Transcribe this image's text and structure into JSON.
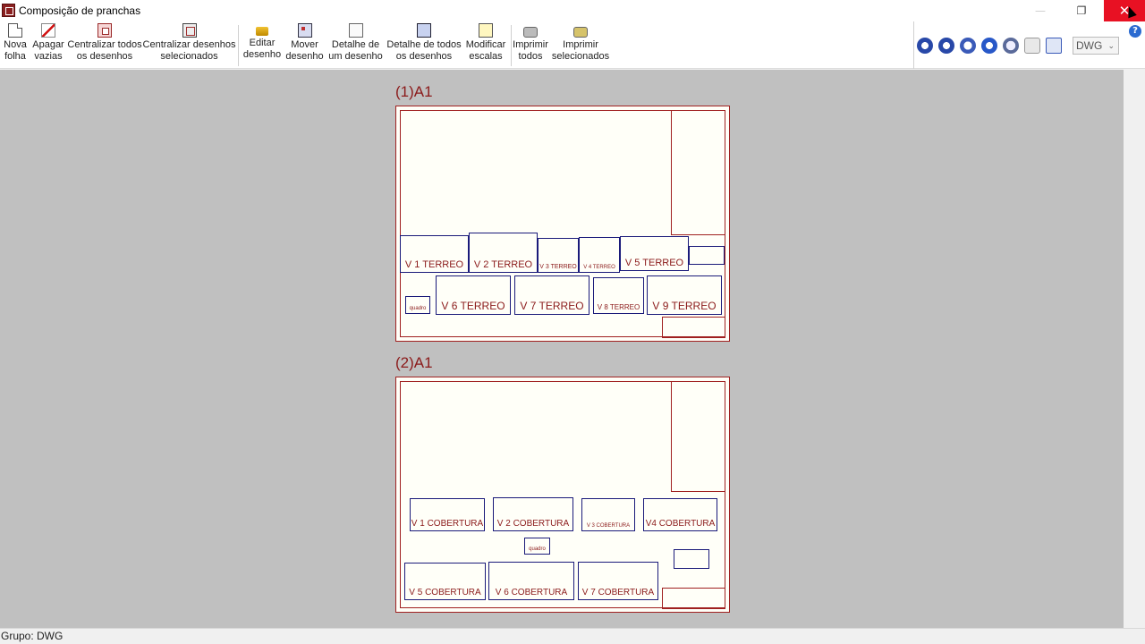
{
  "window": {
    "title": "Composição de pranchas",
    "minimize": "—",
    "restore": "❐",
    "close": "✕"
  },
  "toolbar": {
    "buttons": [
      {
        "label": "Nova\nfolha",
        "icon": "new-page-icon"
      },
      {
        "label": "Apagar\nvazias",
        "icon": "erase-icon"
      },
      {
        "label": "Centralizar todos\nos desenhos",
        "icon": "center-all-icon"
      },
      {
        "label": "Centralizar desenhos\nselecionados",
        "icon": "center-selected-icon"
      },
      {
        "label": "Editar\ndesenho",
        "icon": "edit-icon"
      },
      {
        "label": "Mover\ndesenho",
        "icon": "move-icon"
      },
      {
        "label": "Detalhe de\num desenho",
        "icon": "detail-icon"
      },
      {
        "label": "Detalhe de todos\nos desenhos",
        "icon": "detail-all-icon"
      },
      {
        "label": "Modificar\nescalas",
        "icon": "scale-icon"
      },
      {
        "label": "Imprimir\ntodos",
        "icon": "print-icon"
      },
      {
        "label": "Imprimir\nselecionados",
        "icon": "print-selected-icon"
      }
    ],
    "view_icons": [
      "redraw-icon",
      "zoom-all-icon",
      "zoom-window-icon",
      "refresh-icon",
      "zoom-icon",
      "pan-hand-icon",
      "select-window-icon"
    ],
    "format_select": "DWG",
    "help": "?"
  },
  "sheets": [
    {
      "title": "(1)A1",
      "drawings": [
        "V 1  TERREO",
        "V 2  TERREO",
        "V 3 TERREO",
        "V 4 TERREO",
        "V  5  TERREO",
        "",
        "quadro",
        "V 6 TERREO",
        "V 7 TERREO",
        "V 8 TERREO",
        "V 9 TERREO"
      ]
    },
    {
      "title": "(2)A1",
      "drawings": [
        "V 1 COBERTURA",
        "V 2 COBERTURA",
        "V 3 COBERTURA",
        "V4 COBERTURA",
        "quadro",
        "",
        "V 5 COBERTURA",
        "V 6 COBERTURA",
        "V 7 COBERTURA"
      ]
    }
  ],
  "status": "Grupo: DWG",
  "colors": {
    "sheet_border": "#a02020",
    "drawing_border": "#1a1a7a",
    "text": "#8b1a1a",
    "canvas": "#c0c0c0",
    "close_button": "#e81123"
  }
}
